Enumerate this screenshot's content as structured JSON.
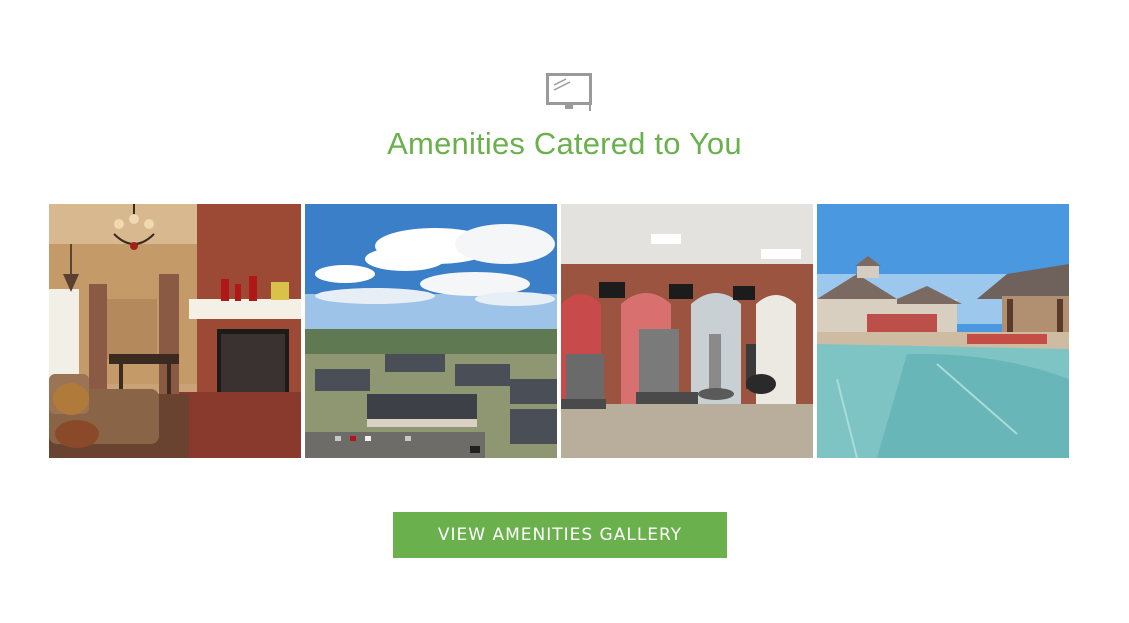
{
  "section": {
    "icon": "monitor-icon",
    "title": "Amenities Catered to You",
    "accent_color": "#6ab04c"
  },
  "gallery": {
    "photos": [
      {
        "icon": "clubhouse-lounge-photo"
      },
      {
        "icon": "aerial-community-photo"
      },
      {
        "icon": "fitness-center-photo"
      },
      {
        "icon": "pool-photo"
      }
    ]
  },
  "cta": {
    "label": "VIEW AMENITIES GALLERY"
  }
}
